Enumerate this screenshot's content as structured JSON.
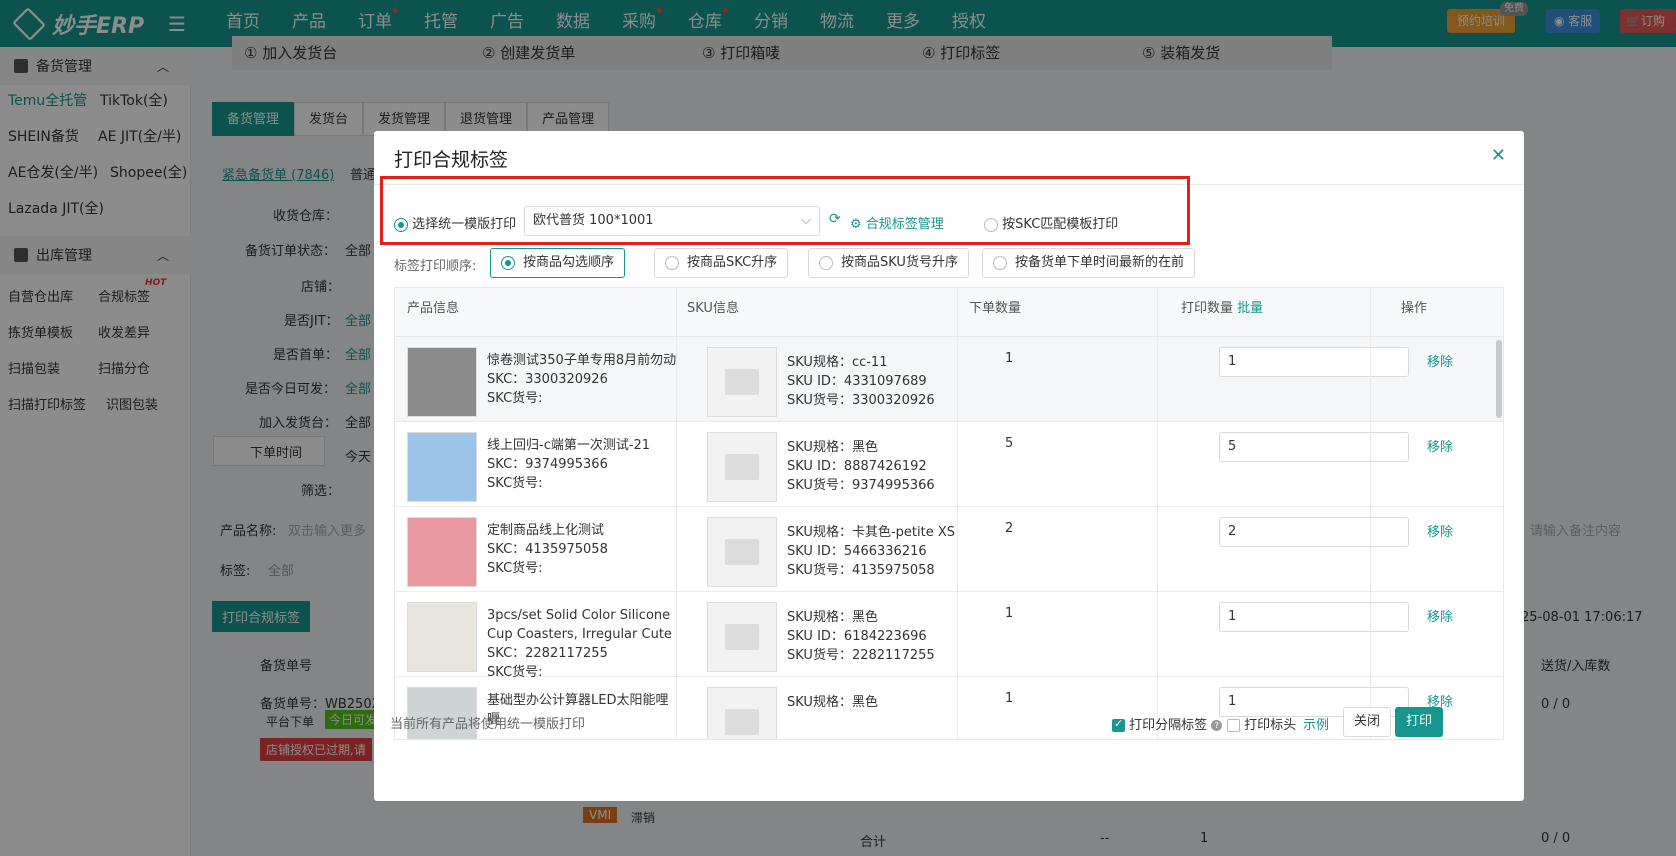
{
  "topbar": {
    "logo": "妙手ERP",
    "nav": [
      {
        "label": "首页",
        "dot": false
      },
      {
        "label": "产品",
        "dot": false
      },
      {
        "label": "订单",
        "dot": true
      },
      {
        "label": "托管",
        "dot": false
      },
      {
        "label": "广告",
        "dot": false
      },
      {
        "label": "数据",
        "dot": false
      },
      {
        "label": "采购",
        "dot": true
      },
      {
        "label": "仓库",
        "dot": true
      },
      {
        "label": "分销",
        "dot": false
      },
      {
        "label": "物流",
        "dot": false
      },
      {
        "label": "更多",
        "dot": false
      },
      {
        "label": "授权",
        "dot": false
      }
    ],
    "train": "预约培训",
    "free": "免费",
    "service": "客服",
    "order": "订购"
  },
  "sidebar": {
    "group1": "备货管理",
    "links1": [
      "Temu全托管",
      "TikTok(全)",
      "SHEIN备货",
      "AE JIT(全/半)",
      "AE仓发(全/半)",
      "Shopee(全)",
      "Lazada JIT(全)"
    ],
    "group2": "出库管理",
    "links2": [
      "自营仓出库",
      "合规标签",
      "拣货单模板",
      "收发差异",
      "扫描包装",
      "扫描分仓",
      "扫描打印标签",
      "识图包装"
    ],
    "hot": "HOT"
  },
  "background": {
    "steps": [
      "① 加入发货台",
      "② 创建发货单",
      "③ 打印箱唛",
      "④ 打印标签",
      "⑤ 装箱发货"
    ],
    "tabs": [
      "备货管理",
      "发货台",
      "发货管理",
      "退货管理",
      "产品管理"
    ],
    "urgent": "紧急备货单 (7846)",
    "normal": "普通",
    "filters": [
      "收货仓库：",
      "备货订单状态：",
      "店铺：",
      "是否JIT：",
      "是否首单：",
      "是否今日可发：",
      "加入发货台："
    ],
    "filter_vals": [
      "全部",
      "全部",
      "全部",
      "全部",
      "全部"
    ],
    "order_time": "下单时间",
    "today": "今天",
    "screen": "筛选：",
    "product_name": "产品名称:",
    "product_name_ph": "双击输入更多",
    "tag": "标签:",
    "tag_val": "全部",
    "remark_ph": "请输入备注内容",
    "print_btn": "打印合规标签",
    "datetime": "25-08-01 17:06:17",
    "col_order": "备货单号",
    "col_ship": "送货/入库数",
    "order_no": "备货单号：WB2502",
    "platform": "平台下单",
    "today_tag": "今日可发",
    "warn": "店铺授权已过期,请",
    "ratio1": "0 / 0",
    "vmi": "VMI",
    "slow": "滞销",
    "total": "合计",
    "dash": "--",
    "total_qty": "1",
    "ratio2": "0 / 0"
  },
  "modal": {
    "title": "打印合规标签",
    "opt_unified": "选择统一模版打印",
    "template": "欧代普货 100*1001",
    "manage": "合规标签管理",
    "opt_skc": "按SKC匹配模板打印",
    "order_label": "标签打印顺序:",
    "order_opts": [
      "按商品勾选顺序",
      "按商品SKC升序",
      "按商品SKU货号升序",
      "按备货单下单时间最新的在前"
    ],
    "columns": [
      "产品信息",
      "SKU信息",
      "下单数量",
      "打印数量",
      "操作"
    ],
    "batch": "批量",
    "rows": [
      {
        "name": "惊卷测试350子单专用8月前勿动",
        "skc": "SKC：3300320926",
        "skc_no": "SKC货号:",
        "spec": "SKU规格：cc-11",
        "sku_id": "SKU ID：4331097689",
        "sku_no": "SKU货号：3300320926",
        "qty": "1",
        "print": "1",
        "action": "移除"
      },
      {
        "name": "线上回归-c端第一次测试-21",
        "skc": "SKC：9374995366",
        "skc_no": "SKC货号:",
        "spec": "SKU规格：黑色",
        "sku_id": "SKU ID：8887426192",
        "sku_no": "SKU货号：9374995366",
        "qty": "5",
        "print": "5",
        "action": "移除"
      },
      {
        "name": "定制商品线上化测试",
        "skc": "SKC：4135975058",
        "skc_no": "SKC货号:",
        "spec": "SKU规格：卡其色-petite XS",
        "sku_id": "SKU ID：5466336216",
        "sku_no": "SKU货号：4135975058",
        "qty": "2",
        "print": "2",
        "action": "移除"
      },
      {
        "name": "3pcs/set Solid Color Silicone Cup Coasters, Irregular Cute ...",
        "skc": "SKC：2282117255",
        "skc_no": "SKC货号:",
        "spec": "SKU规格：黑色",
        "sku_id": "SKU ID：6184223696",
        "sku_no": "SKU货号：2282117255",
        "qty": "1",
        "print": "1",
        "action": "移除"
      },
      {
        "name": "基础型办公计算器LED太阳能哩喱",
        "skc": "",
        "skc_no": "",
        "spec": "SKU规格：黑色",
        "sku_id": "",
        "sku_no": "",
        "qty": "1",
        "print": "1",
        "action": "移除"
      }
    ],
    "note": "当前所有产品将使用统一模版打印",
    "print_sep": "打印分隔标签",
    "print_head": "打印标头",
    "example": "示例",
    "close": "关闭",
    "print": "打印"
  }
}
